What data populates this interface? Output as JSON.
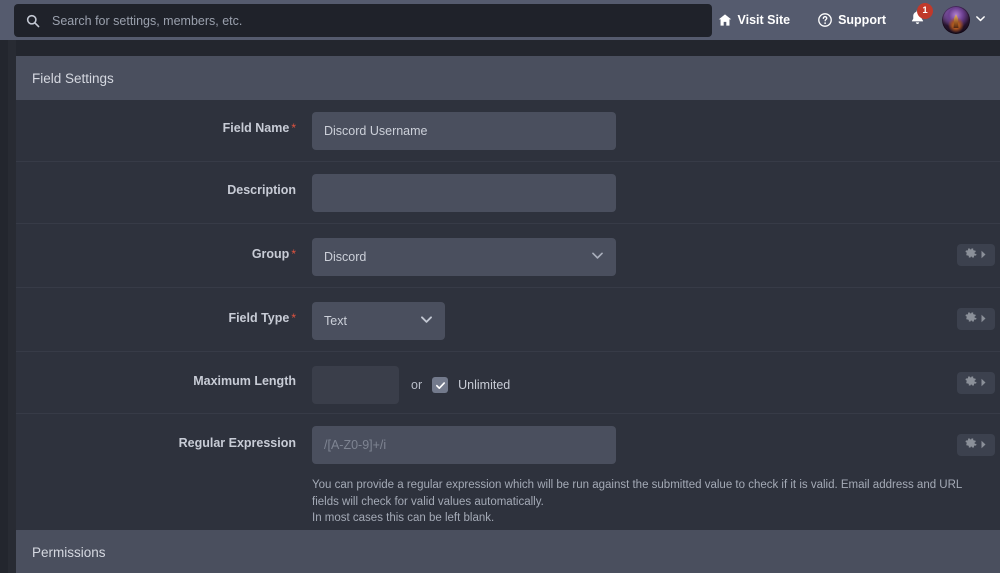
{
  "topbar": {
    "search": {
      "placeholder": "Search for settings, members, etc.",
      "value": "",
      "icon": "search-icon"
    },
    "visit_site": {
      "label": "Visit Site",
      "icon": "home-icon"
    },
    "support": {
      "label": "Support",
      "icon": "question-circle-icon"
    },
    "notifications": {
      "icon": "bell-icon",
      "count": "1"
    },
    "account": {
      "icon": "avatar",
      "caret": "chevron-down-icon"
    }
  },
  "sections": {
    "field_settings": {
      "title": "Field Settings"
    },
    "permissions": {
      "title": "Permissions"
    }
  },
  "form": {
    "field_name": {
      "label": "Field Name",
      "required": "*",
      "value": "Discord Username",
      "placeholder": ""
    },
    "description": {
      "label": "Description",
      "value": "",
      "placeholder": ""
    },
    "group": {
      "label": "Group",
      "required": "*",
      "value": "Discord",
      "caret": "chevron-down-icon",
      "gear": "gear-icon"
    },
    "field_type": {
      "label": "Field Type",
      "required": "*",
      "value": "Text",
      "caret": "chevron-down-icon",
      "gear": "gear-icon"
    },
    "maximum_length": {
      "label": "Maximum Length",
      "value": "",
      "or_text": "or",
      "unlimited_label": "Unlimited",
      "unlimited_checked": true,
      "gear": "gear-icon"
    },
    "regular_expression": {
      "label": "Regular Expression",
      "value": "",
      "placeholder": "/[A-Z0-9]+/i",
      "gear": "gear-icon",
      "help_line1": "You can provide a regular expression which will be run against the submitted value to check if it is valid. Email address and URL fields will check for valid values automatically.",
      "help_line2": "In most cases this can be left blank."
    }
  },
  "colors": {
    "page_bg": "#23262e",
    "topbar_bg": "#555b6e",
    "section_header_bg": "#4a4f5e",
    "row_bg": "#2e323d",
    "input_bg": "#4a4f5e",
    "required_red": "#e0533f",
    "badge_red": "#c0392b",
    "checkbox_bg": "#737a8c"
  }
}
